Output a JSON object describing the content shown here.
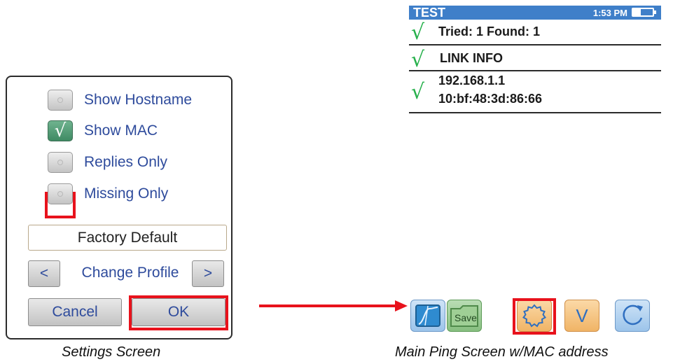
{
  "settings": {
    "options": [
      {
        "label": "Show Hostname",
        "checked": false
      },
      {
        "label": "Show MAC",
        "checked": true
      },
      {
        "label": "Replies Only",
        "checked": false
      },
      {
        "label": "Missing Only",
        "checked": false
      }
    ],
    "profile_name": "Factory Default",
    "prev_label": "<",
    "change_profile_label": "Change Profile",
    "next_label": ">",
    "cancel_label": "Cancel",
    "ok_label": "OK",
    "checkmark_glyph": "√"
  },
  "device": {
    "header_title": "TEST",
    "header_time": "1:53 PM",
    "rows": [
      {
        "lines": [
          "Tried: 1 Found: 1"
        ]
      },
      {
        "lines": [
          "LINK INFO"
        ]
      },
      {
        "lines": [
          "192.168.1.1",
          "10:bf:48:3d:86:66"
        ]
      }
    ],
    "check_glyph": "√",
    "toolbar": [
      {
        "icon": "graph-icon",
        "label": ""
      },
      {
        "icon": "save-icon",
        "label": "Save"
      },
      {
        "icon": "gear-icon",
        "label": ""
      },
      {
        "icon": "chevron-down-icon",
        "label": "V"
      },
      {
        "icon": "refresh-icon",
        "label": ""
      }
    ]
  },
  "captions": {
    "settings": "Settings Screen",
    "main": "Main Ping Screen w/MAC address"
  },
  "colors": {
    "label_blue": "#2e4b9c",
    "highlight_red": "#e8121c",
    "header_blue": "#3f7fc9",
    "check_green": "#27b04c"
  }
}
